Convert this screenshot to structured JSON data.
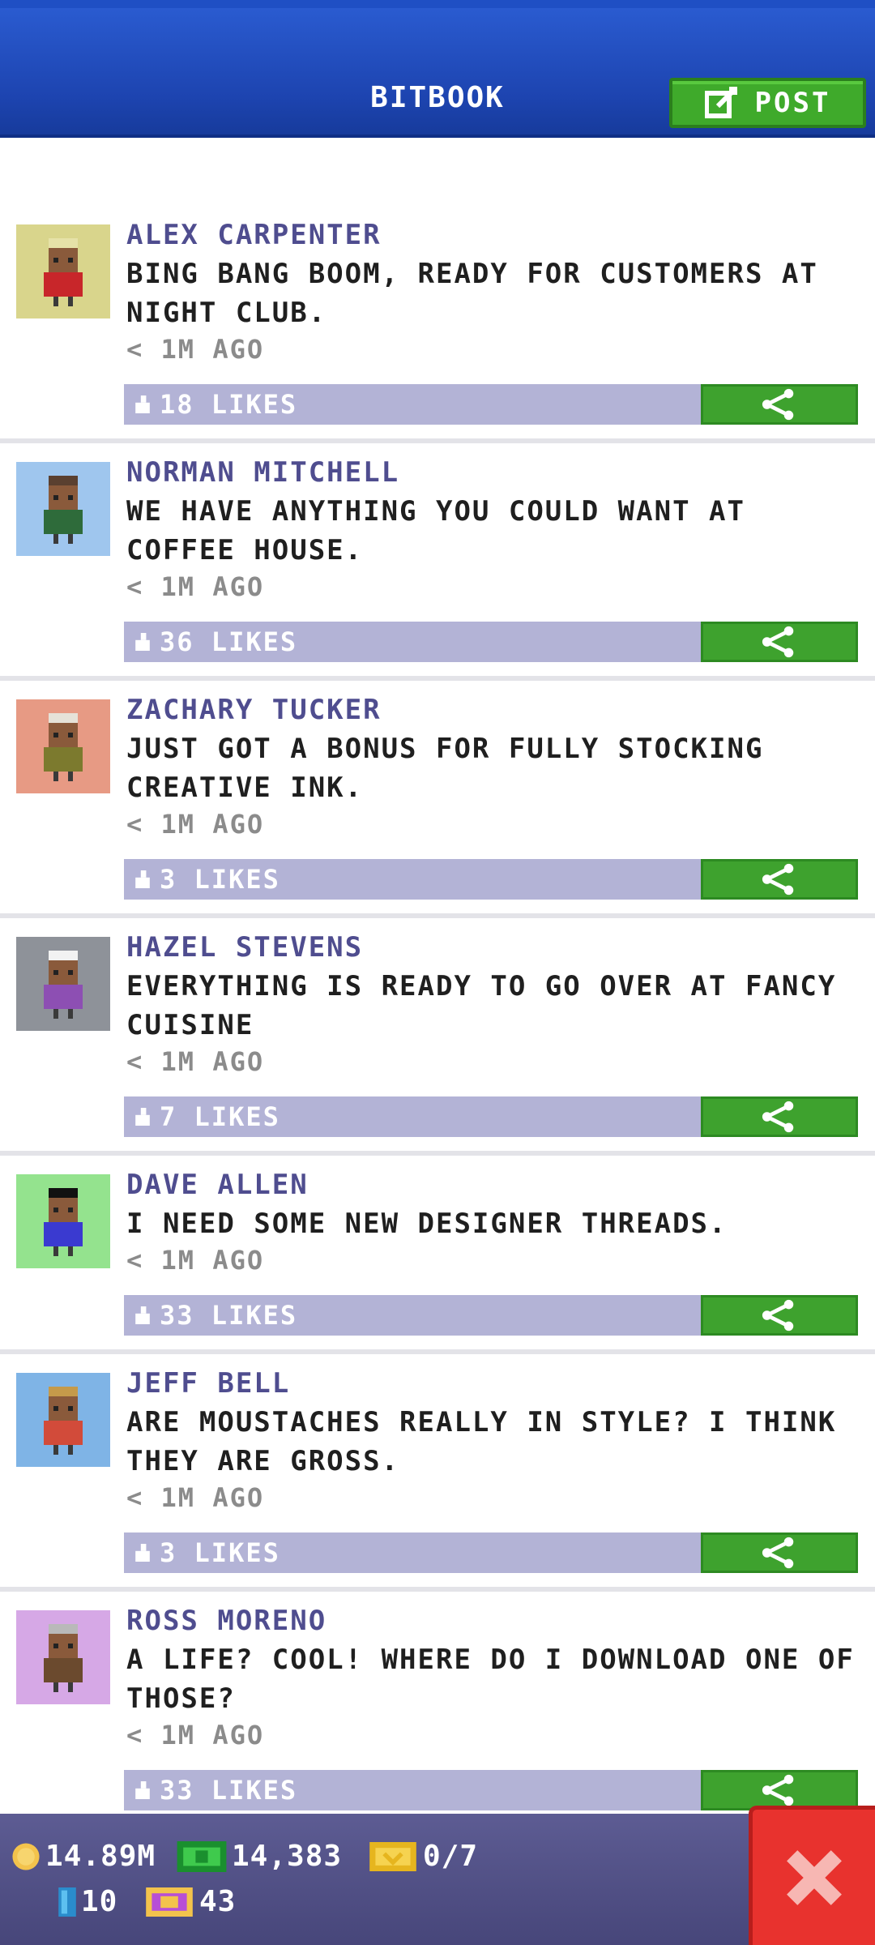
{
  "header": {
    "title": "BITBOOK",
    "post_label": "POST"
  },
  "colors": {
    "header_blue": "#2456c8",
    "likes_bar": "#b3b3d6",
    "share_green": "#3ea22e",
    "name_purple": "#4f4d8f",
    "close_red": "#e8322e"
  },
  "posts": [
    {
      "name": "ALEX CARPENTER",
      "message": "BING BANG BOOM, READY FOR CUSTOMERS AT NIGHT CLUB.",
      "time": "< 1M AGO",
      "likes": "18 LIKES",
      "avatar_bg": "#d9d58c",
      "avatar_icon": "bitizen-red-suit-avatar"
    },
    {
      "name": "NORMAN MITCHELL",
      "message": "WE HAVE ANYTHING YOU COULD WANT AT COFFEE HOUSE.",
      "time": "< 1M AGO",
      "likes": "36 LIKES",
      "avatar_bg": "#9fc6ee",
      "avatar_icon": "bitizen-green-shirt-avatar"
    },
    {
      "name": "ZACHARY TUCKER",
      "message": "JUST GOT A BONUS FOR FULLY STOCKING CREATIVE INK.",
      "time": "< 1M AGO",
      "likes": "3 LIKES",
      "avatar_bg": "#e79a84",
      "avatar_icon": "bitizen-beard-avatar"
    },
    {
      "name": "HAZEL STEVENS",
      "message": "EVERYTHING IS READY TO GO OVER AT FANCY CUISINE",
      "time": "< 1M AGO",
      "likes": "7 LIKES",
      "avatar_bg": "#8e9299",
      "avatar_icon": "bitizen-white-hair-avatar"
    },
    {
      "name": "DAVE ALLEN",
      "message": "I NEED SOME NEW DESIGNER THREADS.",
      "time": "< 1M AGO",
      "likes": "33 LIKES",
      "avatar_bg": "#94e38e",
      "avatar_icon": "bitizen-sunglasses-avatar"
    },
    {
      "name": "JEFF BELL",
      "message": "ARE MOUSTACHES REALLY IN STYLE? I THINK THEY ARE GROSS.",
      "time": "< 1M AGO",
      "likes": "3 LIKES",
      "avatar_bg": "#7fb4e6",
      "avatar_icon": "bitizen-sombrero-avatar"
    },
    {
      "name": "ROSS MORENO",
      "message": "A LIFE? COOL! WHERE DO I DOWNLOAD ONE OF THOSE?",
      "time": "< 1M AGO",
      "likes": "33 LIKES",
      "avatar_bg": "#d6a8e6",
      "avatar_icon": "bitizen-grey-cap-avatar"
    }
  ],
  "status": {
    "coins": "14.89M",
    "bux": "14,383",
    "tickets": "0/7",
    "items": "10",
    "vip": "43"
  }
}
